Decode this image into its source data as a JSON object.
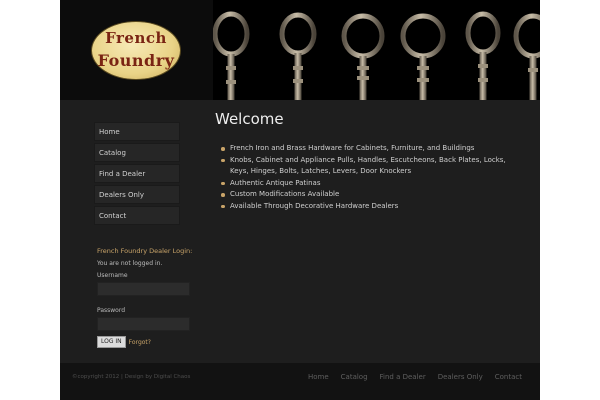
{
  "logo": {
    "line1": "French",
    "line2": "Foundry"
  },
  "sidebar": {
    "nav": [
      {
        "label": "Home"
      },
      {
        "label": "Catalog"
      },
      {
        "label": "Find a Dealer"
      },
      {
        "label": "Dealers Only"
      },
      {
        "label": "Contact"
      }
    ],
    "login": {
      "title": "French Foundry Dealer Login:",
      "status": "You are not logged in.",
      "username_label": "Username",
      "password_label": "Password",
      "button_label": "LOG IN",
      "forgot_label": "Forgot?"
    }
  },
  "main": {
    "heading": "Welcome",
    "features": [
      "French Iron and Brass Hardware for Cabinets, Furniture, and Buildings",
      "Knobs, Cabinet and Appliance Pulls, Handles, Escutcheons, Back Plates, Locks, Keys, Hinges, Bolts, Latches, Levers, Door Knockers",
      "Authentic Antique Patinas",
      "Custom Modifications Available",
      "Available Through Decorative Hardware Dealers"
    ]
  },
  "footer": {
    "copyright": "©copyright 2012 | Design by Digital Chaos",
    "nav": [
      {
        "label": "Home"
      },
      {
        "label": "Catalog"
      },
      {
        "label": "Find a Dealer"
      },
      {
        "label": "Dealers Only"
      },
      {
        "label": "Contact"
      }
    ]
  },
  "colors": {
    "accent": "#c9a469",
    "background": "#1e1e1e",
    "header": "#0c0c0c",
    "logo_text": "#7a2413"
  },
  "icons": [
    "skeleton-key-icon",
    "bullet-dot-icon"
  ]
}
